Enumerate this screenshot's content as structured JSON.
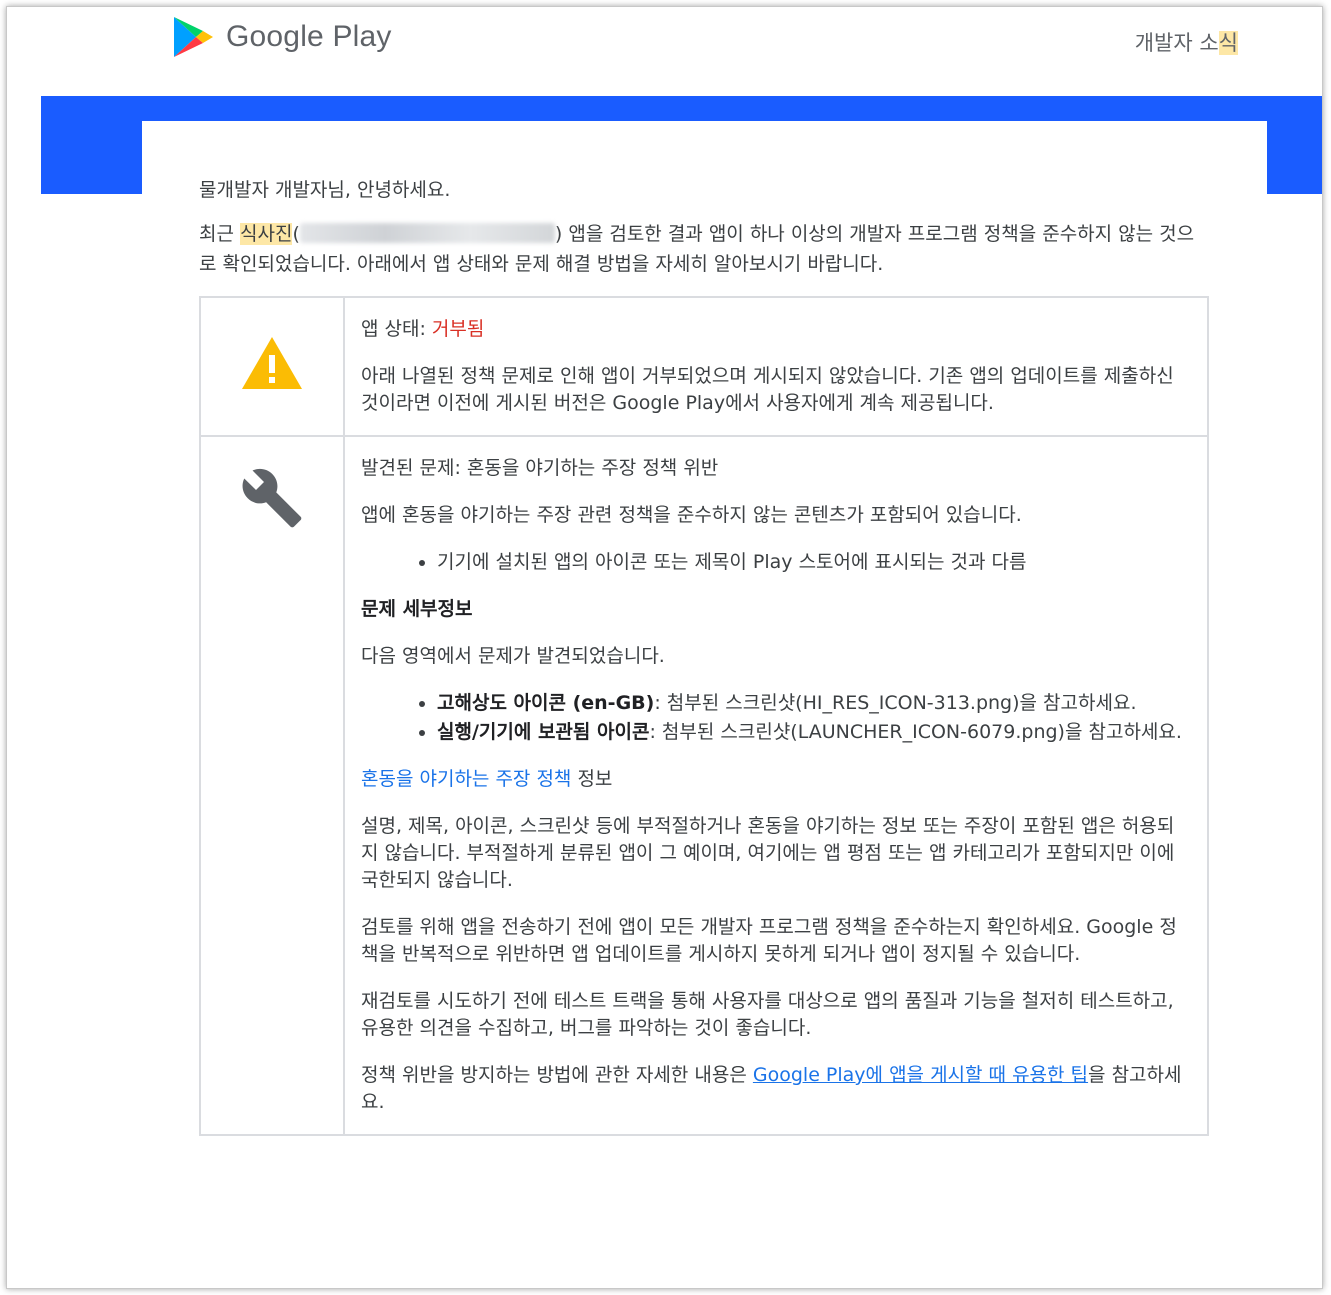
{
  "header": {
    "logo_text": "Google Play",
    "nav_news_prefix": "개발자 소",
    "nav_news_highlight": "식"
  },
  "email": {
    "greeting": "물개발자 개발자님, 안녕하세요.",
    "intro_prefix": "최근 ",
    "app_name": "식사진",
    "paren_open": "(",
    "paren_close": ")",
    "intro_suffix": " 앱을 검토한 결과 앱이 하나 이상의 개발자 프로그램 정책을 준수하지 않는 것으로 확인되었습니다. 아래에서 앱 상태와 문제 해결 방법을 자세히 알아보시기 바랍니다."
  },
  "status": {
    "label": "앱 상태: ",
    "value": "거부됨",
    "description": "아래 나열된 정책 문제로 인해 앱이 거부되었으며 게시되지 않았습니다. 기존 앱의 업데이트를 제출하신 것이라면 이전에 게시된 버전은 Google Play에서 사용자에게 계속 제공됩니다."
  },
  "issue": {
    "title": "발견된 문제: 혼동을 야기하는 주장 정책 위반",
    "summary": "앱에 혼동을 야기하는 주장 관련 정책을 준수하지 않는 콘텐츠가 포함되어 있습니다.",
    "bullet": "기기에 설치된 앱의 아이콘 또는 제목이 Play 스토어에 표시되는 것과 다름",
    "details_heading": "문제 세부정보",
    "details_intro": "다음 영역에서 문제가 발견되었습니다.",
    "details": [
      {
        "label": "고해상도 아이콘 (en-GB)",
        "text": ": 첨부된 스크린샷(HI_RES_ICON-313.png)을 참고하세요."
      },
      {
        "label": "실행/기기에 보관됨 아이콘",
        "text": ": 첨부된 스크린샷(LAUNCHER_ICON-6079.png)을 참고하세요."
      }
    ],
    "policy_link": "혼동을 야기하는 주장 정책",
    "policy_suffix": " 정보",
    "policy_text": "설명, 제목, 아이콘, 스크린샷 등에 부적절하거나 혼동을 야기하는 정보 또는 주장이 포함된 앱은 허용되지 않습니다. 부적절하게 분류된 앱이 그 예이며, 여기에는 앱 평점 또는 앱 카테고리가 포함되지만 이에 국한되지 않습니다.",
    "review_text": "검토를 위해 앱을 전송하기 전에 앱이 모든 개발자 프로그램 정책을 준수하는지 확인하세요. Google 정책을 반복적으로 위반하면 앱 업데이트를 게시하지 못하게 되거나 앱이 정지될 수 있습니다.",
    "test_text": "재검토를 시도하기 전에 테스트 트랙을 통해 사용자를 대상으로 앱의 품질과 기능을 철저히 테스트하고, 유용한 의견을 수집하고, 버그를 파악하는 것이 좋습니다.",
    "tips_prefix": "정책 위반을 방지하는 방법에 관한 자세한 내용은 ",
    "tips_link": "Google Play에 앱을 게시할 때 유용한 팁",
    "tips_suffix": "을 참고하세요."
  },
  "icons": {
    "logo": "google-play-logo",
    "status": "warning-icon",
    "issue": "wrench-icon"
  },
  "colors": {
    "band": "#1a5cff",
    "rejected": "#d93025",
    "link": "#1a73e8",
    "warning": "#fbbc04",
    "highlight": "#fde7a6"
  }
}
